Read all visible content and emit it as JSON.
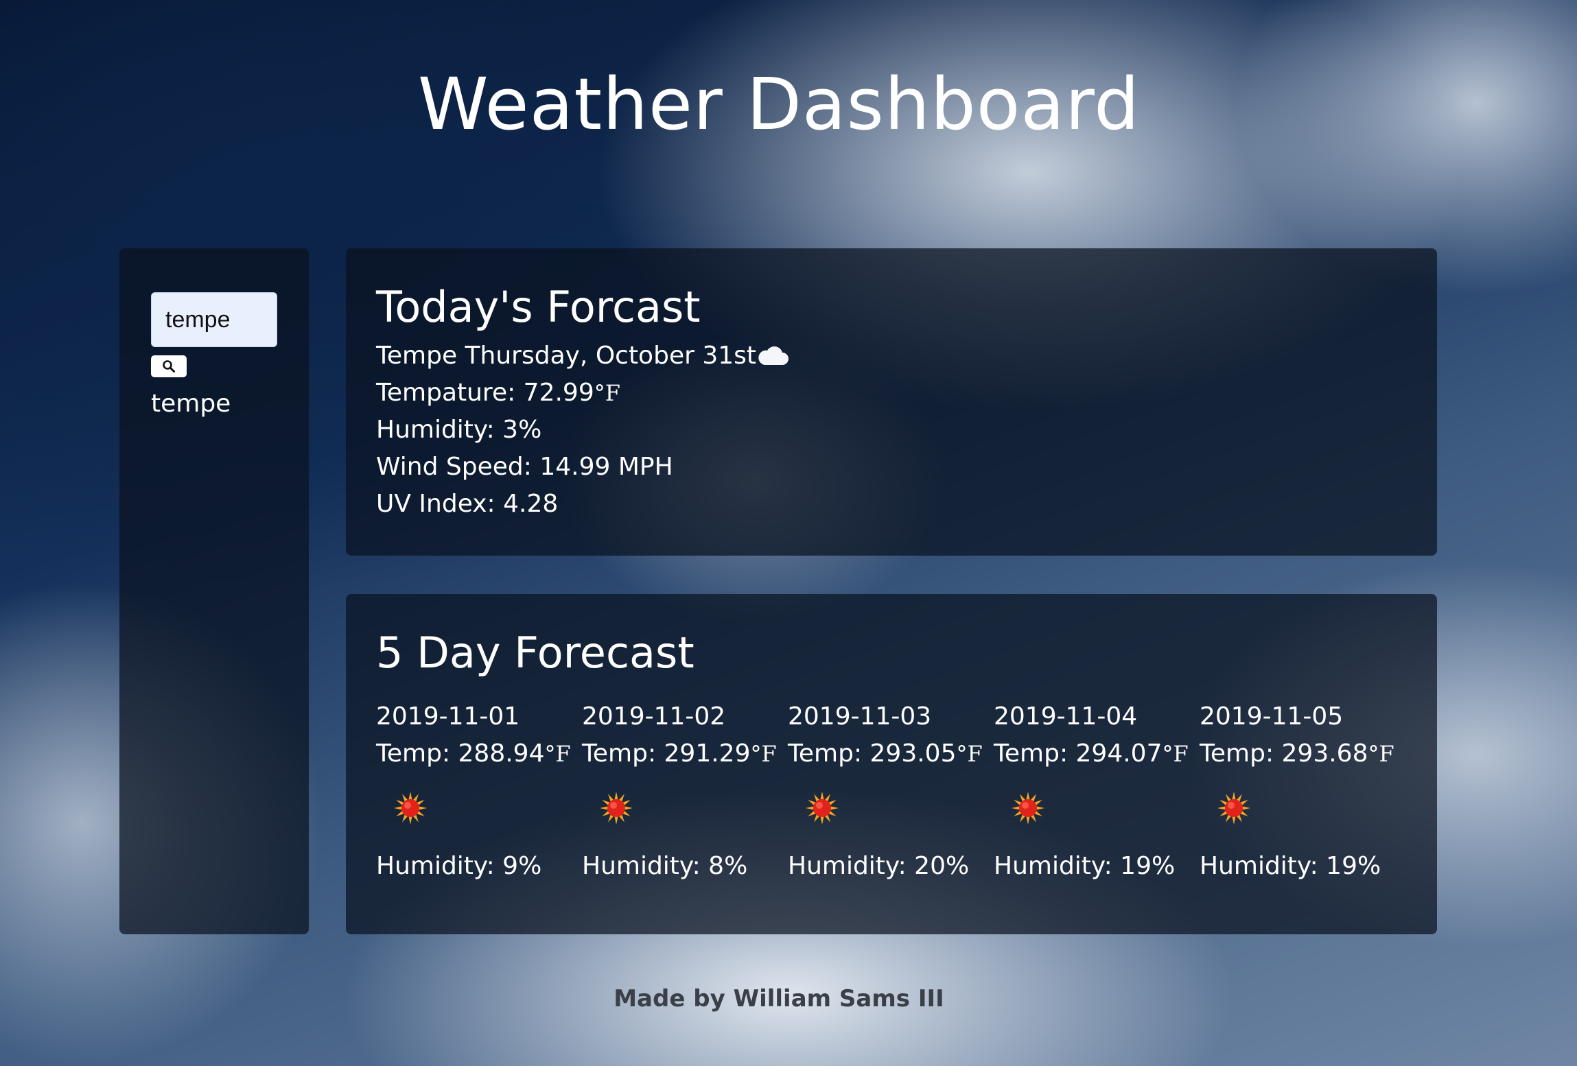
{
  "header": {
    "title": "Weather Dashboard"
  },
  "sidebar": {
    "search_value": "tempe",
    "history": [
      "tempe"
    ]
  },
  "today": {
    "title": "Today's Forcast",
    "location_date": "Tempe Thursday, October 31st",
    "icon": "cloud-icon",
    "temp_label": "Tempature: 72.99",
    "temp_unit": "°F",
    "humidity": "Humidity: 3%",
    "wind": "Wind Speed: 14.99 MPH",
    "uv": "UV Index: 4.28"
  },
  "forecast": {
    "title": "5 Day Forecast",
    "days": [
      {
        "date": "2019-11-01",
        "temp": "Temp: 288.94",
        "unit": "°F",
        "icon": "sun-icon",
        "humidity": "Humidity: 9%"
      },
      {
        "date": "2019-11-02",
        "temp": "Temp: 291.29",
        "unit": "°F",
        "icon": "sun-icon",
        "humidity": "Humidity: 8%"
      },
      {
        "date": "2019-11-03",
        "temp": "Temp: 293.05",
        "unit": "°F",
        "icon": "sun-icon",
        "humidity": "Humidity: 20%"
      },
      {
        "date": "2019-11-04",
        "temp": "Temp: 294.07",
        "unit": "°F",
        "icon": "sun-icon",
        "humidity": "Humidity: 19%"
      },
      {
        "date": "2019-11-05",
        "temp": "Temp: 293.68",
        "unit": "°F",
        "icon": "sun-icon",
        "humidity": "Humidity: 19%"
      }
    ]
  },
  "footer": {
    "text": "Made by William Sams III"
  },
  "colors": {
    "panel": "#0a1220",
    "sun": "#e2231a",
    "sun_rays": "#f5a623",
    "footer_text": "#3a3f48"
  }
}
